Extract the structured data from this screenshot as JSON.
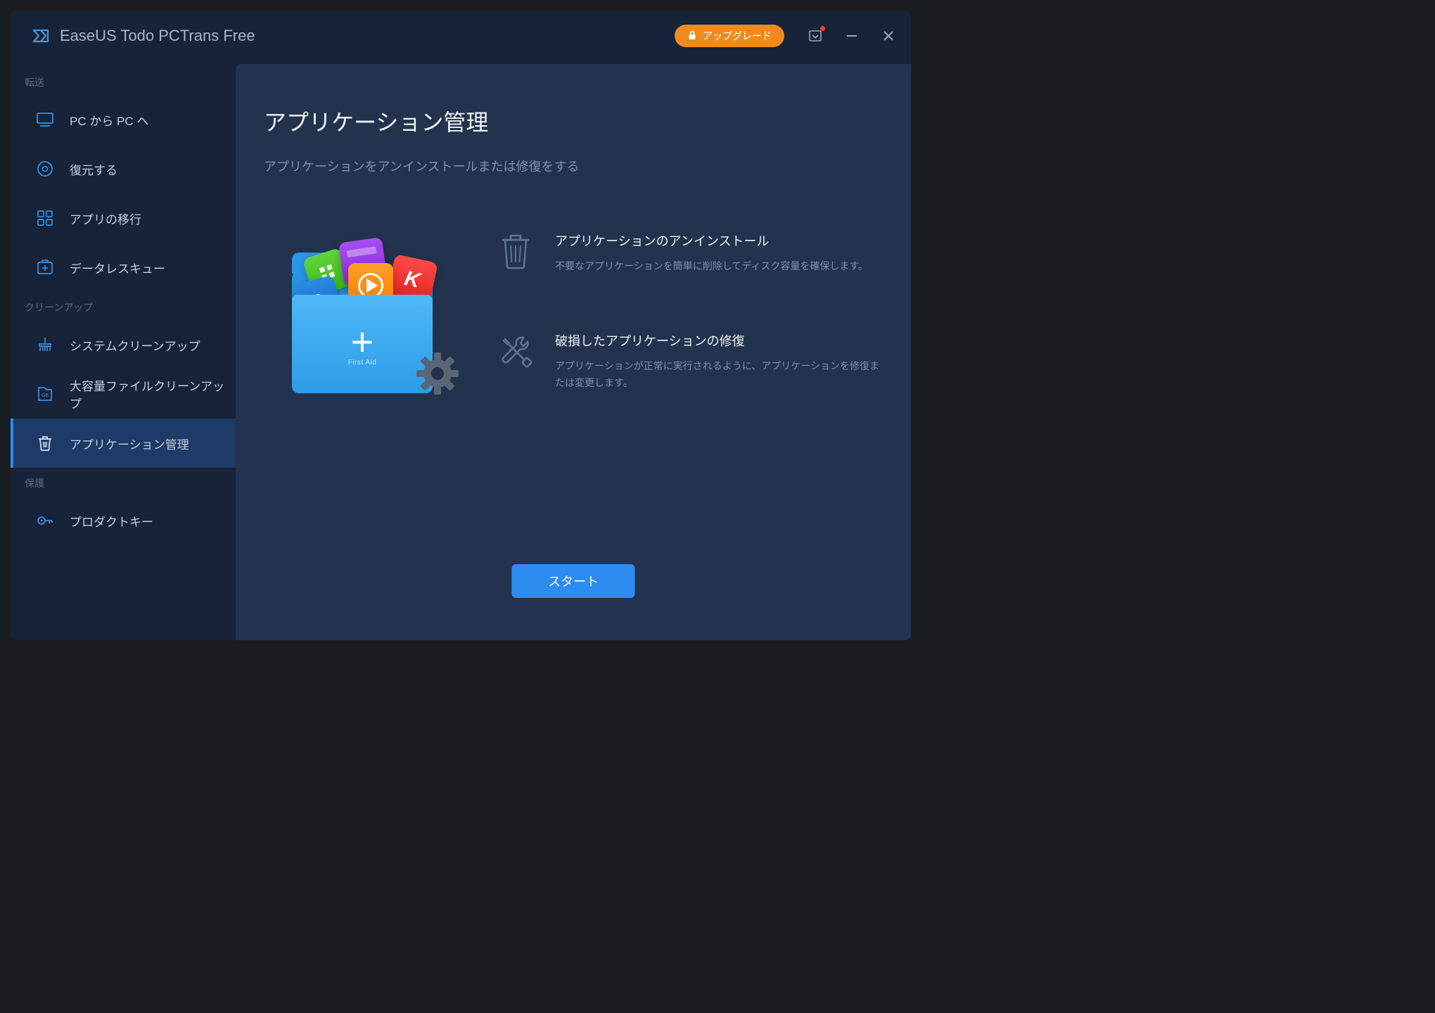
{
  "app": {
    "title": "EaseUS Todo PCTrans Free",
    "upgrade_label": "アップグレード"
  },
  "sidebar": {
    "sections": [
      {
        "label": "転送",
        "items": [
          {
            "id": "pc-to-pc",
            "label": "PC から PC へ"
          },
          {
            "id": "restore",
            "label": "復元する"
          },
          {
            "id": "app-migration",
            "label": "アプリの移行"
          },
          {
            "id": "data-rescue",
            "label": "データレスキュー"
          }
        ]
      },
      {
        "label": "クリーンアップ",
        "items": [
          {
            "id": "system-cleanup",
            "label": "システムクリーンアップ"
          },
          {
            "id": "large-file-cleanup",
            "label": "大容量ファイルクリーンアップ"
          },
          {
            "id": "app-management",
            "label": "アプリケーション管理"
          }
        ]
      },
      {
        "label": "保護",
        "items": [
          {
            "id": "product-key",
            "label": "プロダクトキー"
          }
        ]
      }
    ]
  },
  "page": {
    "title": "アプリケーション管理",
    "subtitle": "アプリケーションをアンインストールまたは修復をする",
    "features": [
      {
        "id": "uninstall",
        "title": "アプリケーションのアンインストール",
        "desc": "不要なアプリケーションを簡単に削除してディスク容量を確保します。"
      },
      {
        "id": "repair",
        "title": "破損したアプリケーションの修復",
        "desc": "アプリケーションが正常に実行されるように、アプリケーションを修復または変更します。"
      }
    ],
    "start_label": "スタート",
    "illustration": {
      "first_aid_label": "First Aid",
      "red_card_letter": "K"
    }
  }
}
